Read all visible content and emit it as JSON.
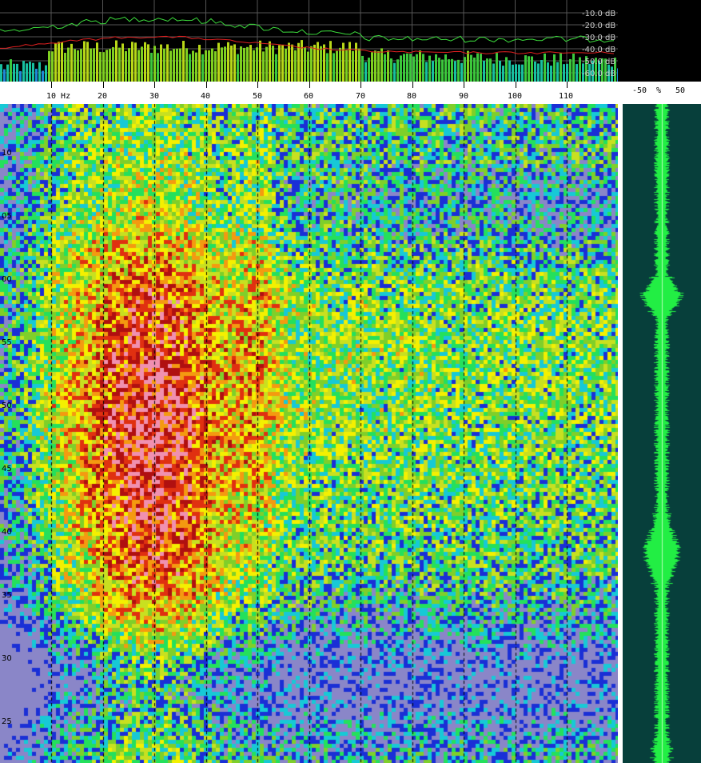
{
  "spectrum": {
    "db_labels": [
      "-10.0 dB",
      "-20.0 dB",
      "-30.0 dB",
      "-40.0 dB",
      "-50.0 dB",
      "-60.0 dB"
    ]
  },
  "frequency_axis": {
    "unit": "Hz",
    "labels": [
      "10 Hz",
      "20",
      "30",
      "40",
      "50",
      "60",
      "70",
      "80",
      "90",
      "100",
      "110"
    ],
    "values": [
      10,
      20,
      30,
      40,
      50,
      60,
      70,
      80,
      90,
      100,
      110
    ]
  },
  "amplitude_axis": {
    "labels": [
      "-50",
      "%",
      "50"
    ]
  },
  "time_axis": {
    "labels": [
      "10",
      "05",
      "00",
      "55",
      "50",
      "45",
      "40",
      "35",
      "30",
      "25"
    ]
  },
  "colors": {
    "spectrum_green_line": "#3cdc3c",
    "spectrum_red_line": "#e02020",
    "waveform_background": "#073f3b",
    "waveform_trace": "#22ee44",
    "spectrogram_low": "#1a2fd6",
    "spectrogram_mid": "#7fcf2a",
    "spectrogram_high": "#f4f000",
    "spectrogram_peak": "#c81414"
  }
}
